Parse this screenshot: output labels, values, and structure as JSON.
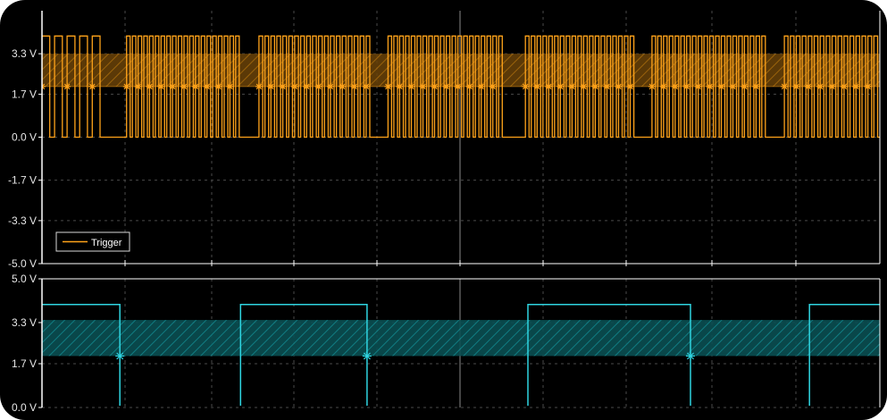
{
  "chart_data": [
    {
      "type": "line",
      "y_tick_labels": [
        "3.3 V",
        "1.7 V",
        "0.0 V",
        "-1.7 V",
        "-3.3 V",
        "-5.0 V"
      ],
      "y_ticks": [
        3.3,
        1.7,
        0.0,
        -1.7,
        -3.3,
        -5.0
      ],
      "ylim": [
        -5.0,
        5.0
      ],
      "legend": {
        "entries": [
          "Trigger"
        ],
        "placement": "bottom-left"
      },
      "grid": true,
      "threshold_band": {
        "low": 2.0,
        "high": 3.3,
        "color": "#b5740e"
      },
      "series": [
        {
          "name": "Trigger",
          "color": "#ffa31a",
          "high": 4.0,
          "low": 0.0,
          "marker_level": 2.0,
          "packets": [
            {
              "start": 0.0,
              "end": 0.075,
              "pulses": 5
            },
            {
              "start": 0.101,
              "end": 0.238,
              "pulses": 20
            },
            {
              "start": 0.259,
              "end": 0.394,
              "pulses": 19
            },
            {
              "start": 0.413,
              "end": 0.552,
              "pulses": 20
            },
            {
              "start": 0.577,
              "end": 0.709,
              "pulses": 19
            },
            {
              "start": 0.728,
              "end": 0.866,
              "pulses": 20
            },
            {
              "start": 0.886,
              "end": 1.0,
              "pulses": 16
            }
          ]
        }
      ]
    },
    {
      "type": "line",
      "y_tick_labels": [
        "5.0 V",
        "3.3 V",
        "1.7 V",
        "0.0 V"
      ],
      "y_ticks": [
        5.0,
        3.3,
        1.7,
        0.0
      ],
      "ylim": [
        0.0,
        5.0
      ],
      "grid": true,
      "threshold_band": {
        "low": 2.0,
        "high": 3.4,
        "color": "#0f7f84"
      },
      "series": [
        {
          "color": "#2fd4e0",
          "high": 4.0,
          "low": 0.0,
          "transitions": [
            0.0,
            0.093,
            0.237,
            0.388,
            0.58,
            0.774,
            0.916
          ],
          "initial_state": "high",
          "markers": [
            0.093,
            0.388,
            0.774
          ],
          "marker_level": 2.0
        }
      ]
    }
  ],
  "icons": {
    "legend_line": "orange-line-swatch",
    "marker": "star-marker"
  }
}
